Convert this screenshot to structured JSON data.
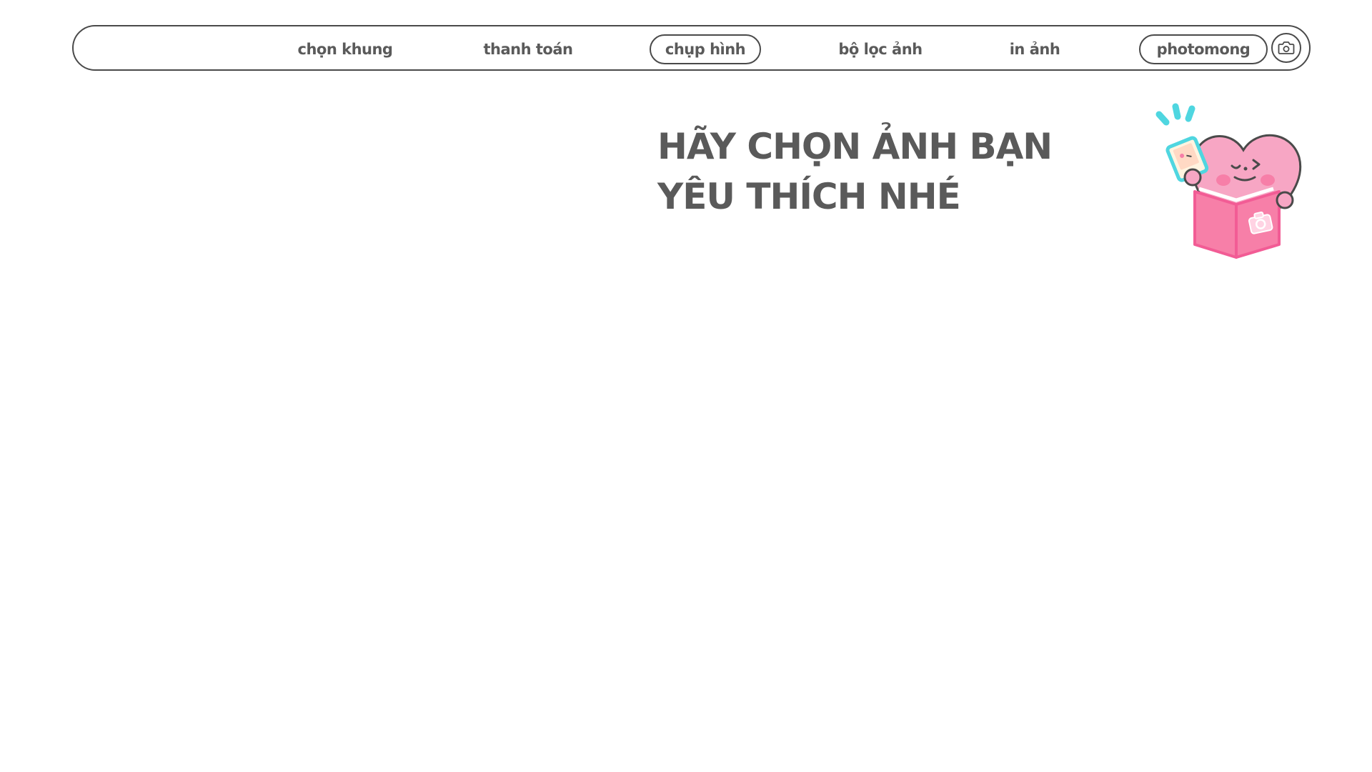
{
  "nav": {
    "items": [
      {
        "label": "chọn khung",
        "active": false
      },
      {
        "label": "thanh toán",
        "active": false
      },
      {
        "label": "chụp hình",
        "active": true
      },
      {
        "label": "bộ lọc ảnh",
        "active": false
      },
      {
        "label": "in ảnh",
        "active": false
      }
    ],
    "brand": "photomong",
    "camera_icon": "camera-icon"
  },
  "headline": {
    "line1": "HÃY CHỌN ẢNH BẠN",
    "line2": "YÊU THÍCH NHÉ"
  },
  "mascot": {
    "icon": "heart-mascot-with-photo-album",
    "colors": {
      "body": "#f7a6c4",
      "album": "#f77fa8",
      "accent": "#4fd6e0",
      "outline": "#4a4a4a"
    }
  },
  "colors": {
    "text": "#5a5a5a",
    "border": "#4a4a4a",
    "background": "#ffffff"
  }
}
